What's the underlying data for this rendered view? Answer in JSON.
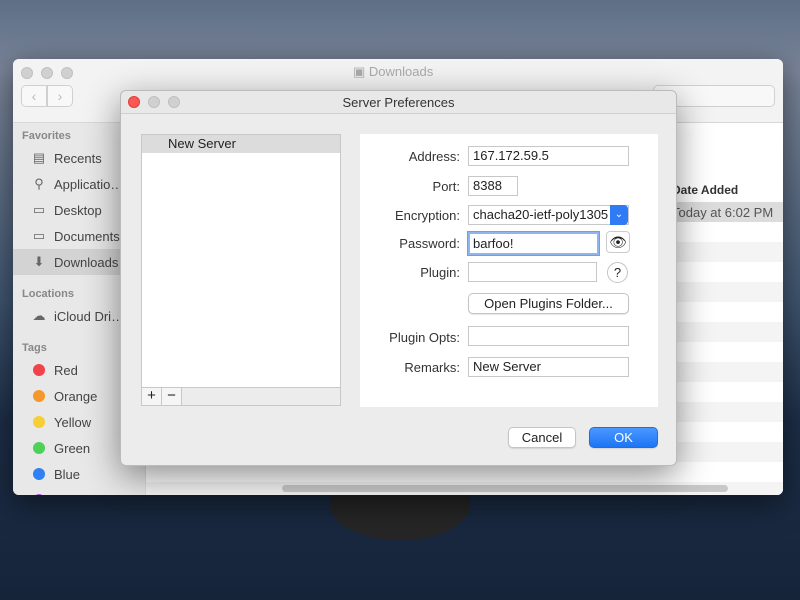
{
  "finder": {
    "title": "Downloads",
    "back": "‹",
    "forward": "›",
    "sidebar": {
      "favorites_header": "Favorites",
      "favorites": [
        {
          "label": "Recents",
          "icon": "recents-icon",
          "glyph": "▤"
        },
        {
          "label": "Applicatio…",
          "icon": "applications-icon",
          "glyph": "⚲"
        },
        {
          "label": "Desktop",
          "icon": "desktop-icon",
          "glyph": "▭"
        },
        {
          "label": "Documents",
          "icon": "documents-icon",
          "glyph": "▭"
        },
        {
          "label": "Downloads",
          "icon": "downloads-icon",
          "glyph": "⬇",
          "selected": true
        }
      ],
      "locations_header": "Locations",
      "locations": [
        {
          "label": "iCloud Dri…",
          "icon": "cloud-icon",
          "glyph": "☁"
        }
      ],
      "tags_header": "Tags",
      "tags": [
        {
          "label": "Red",
          "color": "#f2414a"
        },
        {
          "label": "Orange",
          "color": "#f5972d"
        },
        {
          "label": "Yellow",
          "color": "#f7ce33"
        },
        {
          "label": "Green",
          "color": "#4dd156"
        },
        {
          "label": "Blue",
          "color": "#2f7ff5"
        },
        {
          "label": "Purple",
          "color": "#a352d6"
        }
      ]
    },
    "column_header": "Date Added",
    "row_date": "Today at 6:02 PM"
  },
  "dialog": {
    "title": "Server Preferences",
    "servers": [
      "New Server"
    ],
    "add": "+",
    "remove": "−",
    "labels": {
      "address": "Address:",
      "port": "Port:",
      "encryption": "Encryption:",
      "password": "Password:",
      "plugin": "Plugin:",
      "plugin_opts": "Plugin Opts:",
      "remarks": "Remarks:"
    },
    "values": {
      "address": "167.172.59.5",
      "port": "8388",
      "encryption": "chacha20-ietf-poly1305",
      "password": "barfoo!",
      "plugin": "",
      "plugin_opts": "",
      "remarks": "New Server"
    },
    "open_plugins": "Open Plugins Folder...",
    "help": "?",
    "eye": "👁",
    "cancel": "Cancel",
    "ok": "OK",
    "accent": "#2f7bf5"
  }
}
